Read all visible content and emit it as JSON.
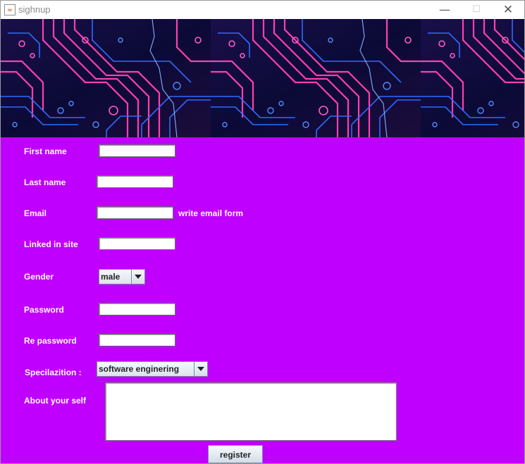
{
  "window": {
    "title": "sighnup",
    "icon": "java-icon",
    "controls": [
      "minimize-icon",
      "maximize-icon",
      "close-icon"
    ]
  },
  "form": {
    "first_name": {
      "label": "First name",
      "value": ""
    },
    "last_name": {
      "label": "Last name",
      "value": ""
    },
    "email": {
      "label": "Email",
      "value": "",
      "hint": "write email form"
    },
    "linkedin": {
      "label": "Linked in site",
      "value": ""
    },
    "gender": {
      "label": "Gender",
      "selected": "male"
    },
    "password": {
      "label": "Password",
      "value": ""
    },
    "repassword": {
      "label": "Re password",
      "value": ""
    },
    "specialization": {
      "label": "Specilazition :",
      "selected": "software enginering"
    },
    "about": {
      "label": "About your self",
      "value": ""
    },
    "register_label": "register"
  },
  "colors": {
    "form_background": "#c000ff",
    "banner_dark": "#0d0a3b",
    "circuit_pink": "#ff3fb0",
    "circuit_blue": "#2f6bff"
  }
}
